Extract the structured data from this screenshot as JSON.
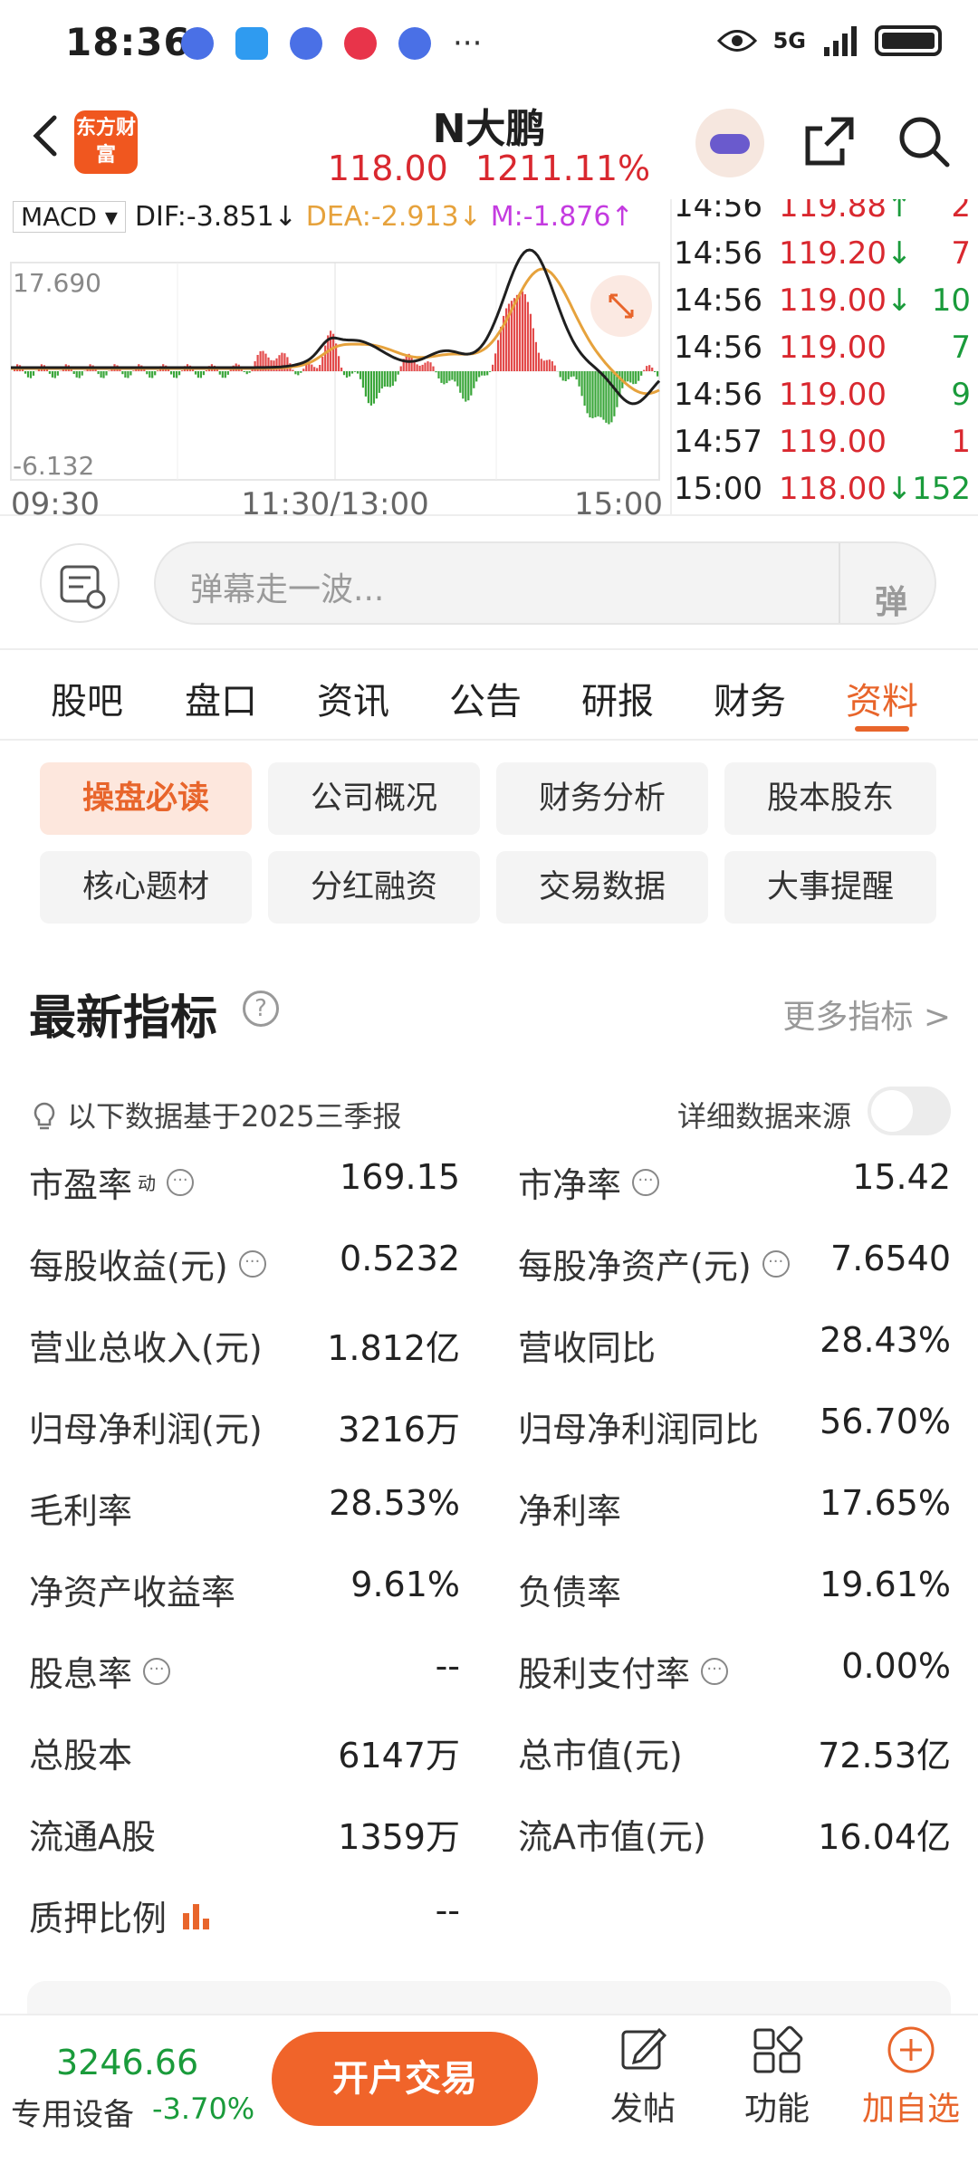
{
  "status_bar": {
    "time": "18:36",
    "network": "5G"
  },
  "header": {
    "logo_text": "东方财富",
    "stock_name": "N大鹏",
    "price": "118.00",
    "change_pct": "1211.11%"
  },
  "chart": {
    "indicator": "MACD",
    "dif": "DIF:-3.851",
    "dea": "DEA:-2.913",
    "m": "M:-1.876",
    "y_max": "17.690",
    "y_min": "-6.132",
    "x_labels": [
      "09:30",
      "11:30/13:00",
      "15:00"
    ],
    "colors": {
      "dif": "#1f1f1f",
      "dea": "#e6a23c",
      "m": "#c43be0",
      "up": "#e34a4a",
      "down": "#3aa63a"
    }
  },
  "trades": [
    {
      "time": "14:56",
      "price": "119.88",
      "dir": "↑",
      "vol": "2",
      "vol_color": "red"
    },
    {
      "time": "14:56",
      "price": "119.20",
      "dir": "↓",
      "vol": "7",
      "vol_color": "red"
    },
    {
      "time": "14:56",
      "price": "119.00",
      "dir": "↓",
      "vol": "10",
      "vol_color": "green"
    },
    {
      "time": "14:56",
      "price": "119.00",
      "dir": "",
      "vol": "7",
      "vol_color": "green"
    },
    {
      "time": "14:56",
      "price": "119.00",
      "dir": "",
      "vol": "9",
      "vol_color": "green"
    },
    {
      "time": "14:57",
      "price": "119.00",
      "dir": "",
      "vol": "1",
      "vol_color": "red"
    },
    {
      "time": "15:00",
      "price": "118.00",
      "dir": "↓",
      "vol": "152",
      "vol_color": "green"
    }
  ],
  "danmu": {
    "placeholder": "弹幕走一波...",
    "send_label": "弹"
  },
  "tabs": [
    {
      "label": "股吧"
    },
    {
      "label": "盘口"
    },
    {
      "label": "资讯"
    },
    {
      "label": "公告"
    },
    {
      "label": "研报"
    },
    {
      "label": "财务"
    },
    {
      "label": "资料",
      "active": true
    }
  ],
  "sub_buttons": [
    {
      "label": "操盘必读",
      "active": true
    },
    {
      "label": "公司概况"
    },
    {
      "label": "财务分析"
    },
    {
      "label": "股本股东"
    },
    {
      "label": "核心题材"
    },
    {
      "label": "分红融资"
    },
    {
      "label": "交易数据"
    },
    {
      "label": "大事提醒"
    }
  ],
  "indicators": {
    "title": "最新指标",
    "more_label": "更多指标 >",
    "basis_note": "以下数据基于2025三季报",
    "source_label": "详细数据来源",
    "rows": [
      {
        "l_label": "市盈率",
        "l_sup": "动",
        "l_info": true,
        "l_value": "169.15",
        "r_label": "市净率",
        "r_info": true,
        "r_value": "15.42"
      },
      {
        "l_label": "每股收益(元)",
        "l_info": true,
        "l_value": "0.5232",
        "r_label": "每股净资产(元)",
        "r_info": true,
        "r_value": "7.6540"
      },
      {
        "l_label": "营业总收入(元)",
        "l_value": "1.812亿",
        "r_label": "营收同比",
        "r_value": "28.43%",
        "r_red": true
      },
      {
        "l_label": "归母净利润(元)",
        "l_value": "3216万",
        "r_label": "归母净利润同比",
        "r_value": "56.70%",
        "r_red": true
      },
      {
        "l_label": "毛利率",
        "l_value": "28.53%",
        "r_label": "净利率",
        "r_value": "17.65%"
      },
      {
        "l_label": "净资产收益率",
        "l_value": "9.61%",
        "r_label": "负债率",
        "r_value": "19.61%"
      },
      {
        "l_label": "股息率",
        "l_info": true,
        "l_value": "--",
        "r_label": "股利支付率",
        "r_info": true,
        "r_value": "0.00%"
      },
      {
        "l_label": "总股本",
        "l_value": "6147万",
        "r_label": "总市值(元)",
        "r_value": "72.53亿"
      },
      {
        "l_label": "流通A股",
        "l_value": "1359万",
        "r_label": "流A市值(元)",
        "r_value": "16.04亿"
      },
      {
        "l_label": "质押比例",
        "l_chart": true,
        "l_value": "--"
      }
    ]
  },
  "bottom_bar": {
    "index_value": "3246.66",
    "index_label": "专用设备",
    "index_change": "-3.70%",
    "trade_button": "开户交易",
    "nav": [
      {
        "label": "发帖",
        "icon": "edit-icon"
      },
      {
        "label": "功能",
        "icon": "grid-icon"
      },
      {
        "label": "加自选",
        "icon": "add-circle-icon"
      }
    ]
  }
}
